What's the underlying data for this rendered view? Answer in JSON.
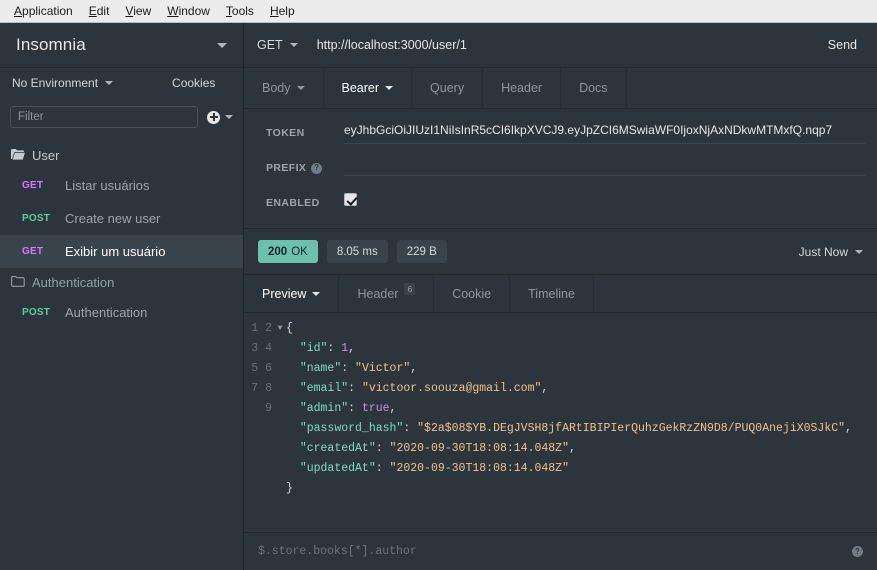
{
  "menubar": {
    "items": [
      {
        "mnemonic": "A",
        "rest": "pplication"
      },
      {
        "mnemonic": "E",
        "rest": "dit"
      },
      {
        "mnemonic": "V",
        "rest": "iew"
      },
      {
        "mnemonic": "W",
        "rest": "indow"
      },
      {
        "mnemonic": "T",
        "rest": "ools"
      },
      {
        "mnemonic": "H",
        "rest": "elp"
      }
    ]
  },
  "sidebar": {
    "workspace_title": "Insomnia",
    "environment_label": "No Environment",
    "cookies_label": "Cookies",
    "filter_placeholder": "Filter",
    "filter_value": "",
    "groups": [
      {
        "name": "User",
        "expanded": true,
        "requests": [
          {
            "method": "GET",
            "name": "Listar usuários",
            "active": false
          },
          {
            "method": "POST",
            "name": "Create new user",
            "active": false
          },
          {
            "method": "GET",
            "name": "Exibir um usuário",
            "active": true
          }
        ]
      },
      {
        "name": "Authentication",
        "expanded": false,
        "requests": [
          {
            "method": "POST",
            "name": "Authentication",
            "active": false
          }
        ]
      }
    ]
  },
  "request": {
    "method": "GET",
    "url": "http://localhost:3000/user/1",
    "send_label": "Send",
    "tabs": [
      {
        "label": "Body",
        "active": false,
        "has_caret": true,
        "badge": null
      },
      {
        "label": "Bearer",
        "active": true,
        "has_caret": true,
        "badge": null
      },
      {
        "label": "Query",
        "active": false,
        "has_caret": false,
        "badge": null
      },
      {
        "label": "Header",
        "active": false,
        "has_caret": false,
        "badge": null
      },
      {
        "label": "Docs",
        "active": false,
        "has_caret": false,
        "badge": null
      }
    ],
    "auth": {
      "token_label": "TOKEN",
      "token_value": "eyJhbGciOiJIUzI1NiIsInR5cCI6IkpXVCJ9.eyJpZCI6MSwiaWF0IjoxNjAxNDkwMTMxfQ.nqp7",
      "prefix_label": "PREFIX",
      "prefix_value": "",
      "enabled_label": "ENABLED",
      "enabled_checked": true
    }
  },
  "response": {
    "status_code": "200",
    "status_text": "OK",
    "time": "8.05 ms",
    "size": "229 B",
    "timestamp": "Just Now",
    "tabs": [
      {
        "label": "Preview",
        "active": true,
        "has_caret": true,
        "badge": null
      },
      {
        "label": "Header",
        "active": false,
        "has_caret": false,
        "badge": "6"
      },
      {
        "label": "Cookie",
        "active": false,
        "has_caret": false,
        "badge": null
      },
      {
        "label": "Timeline",
        "active": false,
        "has_caret": false,
        "badge": null
      }
    ],
    "body": {
      "line_numbers": [
        "1",
        "2",
        "3",
        "4",
        "5",
        "6",
        "7",
        "8",
        "9"
      ],
      "json": {
        "id": 1,
        "name": "Victor",
        "email": "victoor.soouza@gmail.com",
        "admin": true,
        "password_hash": "$2a$08$YB.DEgJVSH8jfARtIBIPIerQuhzGekRzZN9D8/PUQ0AnejiX0SJkC",
        "createdAt": "2020-09-30T18:08:14.048Z",
        "updatedAt": "2020-09-30T18:08:14.048Z"
      }
    },
    "filter_placeholder": "$.store.books[*].author",
    "filter_value": ""
  },
  "colors": {
    "background": "#2d353c",
    "panel_border": "#222a30",
    "selected_row": "#39434b",
    "method_get": "#d57bff",
    "method_post": "#62c9a6",
    "status_ok": "#6bc2ab",
    "text_primary": "#e4e8ea",
    "text_muted": "#8c979e",
    "json_key": "#7fdbca",
    "json_string": "#ecc48d",
    "json_literal": "#c792ea"
  }
}
